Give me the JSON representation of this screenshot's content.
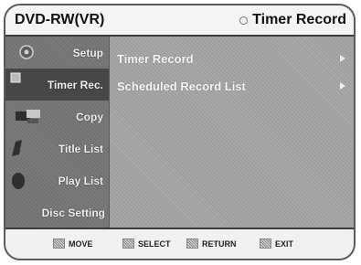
{
  "header": {
    "disc_type": "DVD-RW(VR)",
    "title": "Timer Record"
  },
  "sidebar": {
    "items": [
      {
        "label": "Setup",
        "icon": "gear-icon",
        "active": false
      },
      {
        "label": "Timer Rec.",
        "icon": "timer-icon",
        "active": true
      },
      {
        "label": "Copy",
        "icon": "copy-icon",
        "active": false
      },
      {
        "label": "Title List",
        "icon": "title-list-icon",
        "active": false
      },
      {
        "label": "Play List",
        "icon": "play-list-icon",
        "active": false
      },
      {
        "label": "Disc Setting",
        "icon": "disc-icon",
        "active": false
      }
    ]
  },
  "main": {
    "items": [
      {
        "label": "Timer Record"
      },
      {
        "label": "Scheduled Record List"
      }
    ]
  },
  "footer": {
    "move": "MOVE",
    "select": "SELECT",
    "return": "RETURN",
    "exit": "EXIT"
  }
}
